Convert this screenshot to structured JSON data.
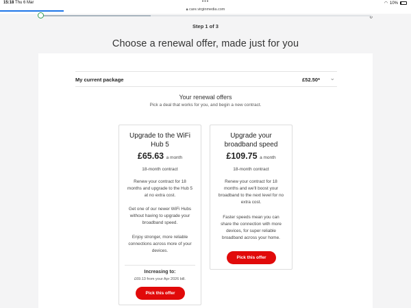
{
  "status_bar": {
    "time": "15:18",
    "date": "Thu 6 Mar",
    "url": "care.virginmedia.com",
    "battery": "10%",
    "menu_dots": "•••"
  },
  "stepper": {
    "label": "Step 1 of 3",
    "progress": 0.33,
    "complete_color": "#2e9c52"
  },
  "page": {
    "title": "Choose a renewal offer, made just for you"
  },
  "current_package": {
    "label": "My current package",
    "price": "£52.50*"
  },
  "offers": {
    "title": "Your renewal offers",
    "subtitle": "Pick a deal that works for you, and begin a new contract.",
    "cards": [
      {
        "title": "Upgrade to the WiFi Hub 5",
        "price": "£65.63",
        "per": "a month",
        "contract": "18-month contract",
        "paragraphs": [
          "Renew your contract for 18 months and upgrade to the Hub 5 at no extra cost.",
          "Get one of our newer WiFi Hubs without having to upgrade your broadband speed.",
          "Enjoy stronger, more reliable connections across more of your devices."
        ],
        "increase_label": "Increasing to:",
        "increase_text": "£69.13 from your Apr 2026 bill.",
        "button": "Pick this offer"
      },
      {
        "title": "Upgrade your broadband speed",
        "price": "£109.75",
        "per": "a month",
        "contract": "18-month contract",
        "paragraphs": [
          "Renew your contract for 18 months and we'll boost your broadband to the next level for no extra cost.",
          "Faster speeds mean you can share the connection with more devices, for super reliable broadband across your home."
        ],
        "button": "Pick this offer"
      }
    ]
  },
  "colors": {
    "accent": "#e10a0a",
    "background": "#f4f4f5",
    "browser_progress": "#1a73e8"
  }
}
